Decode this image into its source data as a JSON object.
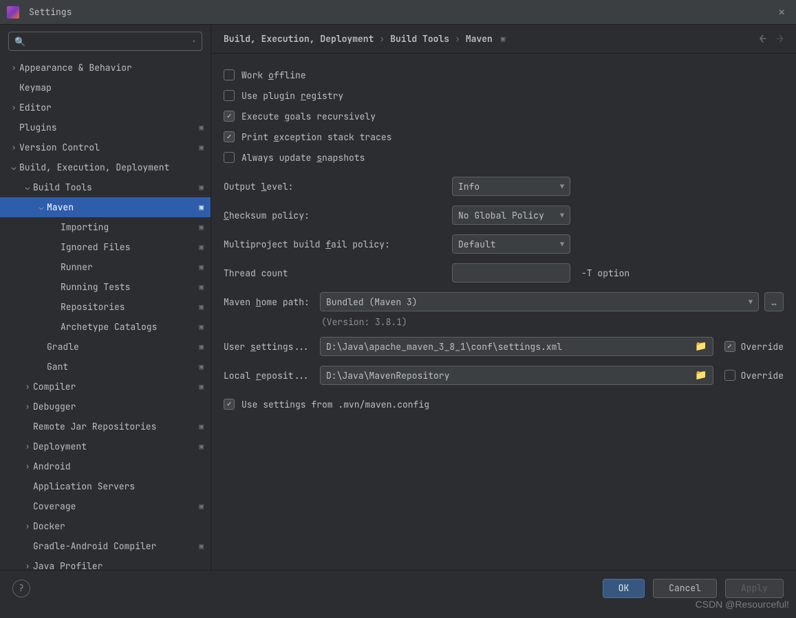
{
  "window": {
    "title": "Settings"
  },
  "search": {
    "placeholder": ""
  },
  "tree": [
    {
      "label": "Appearance & Behavior",
      "indent": 0,
      "arrow": "right",
      "mod": false
    },
    {
      "label": "Keymap",
      "indent": 0,
      "arrow": "",
      "mod": false
    },
    {
      "label": "Editor",
      "indent": 0,
      "arrow": "right",
      "mod": false
    },
    {
      "label": "Plugins",
      "indent": 0,
      "arrow": "",
      "mod": true
    },
    {
      "label": "Version Control",
      "indent": 0,
      "arrow": "right",
      "mod": true
    },
    {
      "label": "Build, Execution, Deployment",
      "indent": 0,
      "arrow": "down",
      "mod": false
    },
    {
      "label": "Build Tools",
      "indent": 1,
      "arrow": "down",
      "mod": true
    },
    {
      "label": "Maven",
      "indent": 2,
      "arrow": "down",
      "mod": true,
      "selected": true
    },
    {
      "label": "Importing",
      "indent": 3,
      "arrow": "",
      "mod": true
    },
    {
      "label": "Ignored Files",
      "indent": 3,
      "arrow": "",
      "mod": true
    },
    {
      "label": "Runner",
      "indent": 3,
      "arrow": "",
      "mod": true
    },
    {
      "label": "Running Tests",
      "indent": 3,
      "arrow": "",
      "mod": true
    },
    {
      "label": "Repositories",
      "indent": 3,
      "arrow": "",
      "mod": true
    },
    {
      "label": "Archetype Catalogs",
      "indent": 3,
      "arrow": "",
      "mod": true
    },
    {
      "label": "Gradle",
      "indent": 2,
      "arrow": "",
      "mod": true
    },
    {
      "label": "Gant",
      "indent": 2,
      "arrow": "",
      "mod": true
    },
    {
      "label": "Compiler",
      "indent": 1,
      "arrow": "right",
      "mod": true
    },
    {
      "label": "Debugger",
      "indent": 1,
      "arrow": "right",
      "mod": false
    },
    {
      "label": "Remote Jar Repositories",
      "indent": 1,
      "arrow": "",
      "mod": true
    },
    {
      "label": "Deployment",
      "indent": 1,
      "arrow": "right",
      "mod": true
    },
    {
      "label": "Android",
      "indent": 1,
      "arrow": "right",
      "mod": false
    },
    {
      "label": "Application Servers",
      "indent": 1,
      "arrow": "",
      "mod": false
    },
    {
      "label": "Coverage",
      "indent": 1,
      "arrow": "",
      "mod": true
    },
    {
      "label": "Docker",
      "indent": 1,
      "arrow": "right",
      "mod": false
    },
    {
      "label": "Gradle-Android Compiler",
      "indent": 1,
      "arrow": "",
      "mod": true
    },
    {
      "label": "Java Profiler",
      "indent": 1,
      "arrow": "right",
      "mod": false
    }
  ],
  "breadcrumb": {
    "items": [
      "Build, Execution, Deployment",
      "Build Tools",
      "Maven"
    ]
  },
  "checks": {
    "work_offline": {
      "label_pre": "Work ",
      "u": "o",
      "label_post": "ffline",
      "checked": false
    },
    "use_plugin_registry": {
      "label_pre": "Use plugin ",
      "u": "r",
      "label_post": "egistry",
      "checked": false
    },
    "exec_goals": {
      "label_pre": "Execute ",
      "u": "g",
      "label_post": "oals recursively",
      "checked": true
    },
    "print_exc": {
      "label_pre": "Print ",
      "u": "e",
      "label_post": "xception stack traces",
      "checked": true
    },
    "always_update": {
      "label_pre": "Always update ",
      "u": "s",
      "label_post": "napshots",
      "checked": false
    },
    "use_mvn_config": {
      "label": "Use settings from .mvn/maven.config",
      "checked": true
    }
  },
  "fields": {
    "output_level": {
      "label_pre": "Output ",
      "u": "l",
      "label_post": "evel:",
      "value": "Info"
    },
    "checksum": {
      "label_pre": "",
      "u": "C",
      "label_post": "hecksum policy:",
      "value": "No Global Policy"
    },
    "multiproject": {
      "label_pre": "Multiproject build ",
      "u": "f",
      "label_post": "ail policy:",
      "value": "Default"
    },
    "thread_count": {
      "label": "Thread count",
      "value": "",
      "suffix": "-T option"
    },
    "maven_home": {
      "label_pre": "Maven ",
      "u": "h",
      "label_post": "ome path:",
      "value": "Bundled (Maven 3)",
      "version": "(Version: 3.8.1)"
    },
    "user_settings": {
      "label_pre": "User ",
      "u": "s",
      "label_post": "ettings...",
      "value": "D:\\Java\\apache_maven_3_8_1\\conf\\settings.xml",
      "override_label": "Override",
      "override_checked": true
    },
    "local_repo": {
      "label_pre": "Local ",
      "u": "r",
      "label_post": "eposit...",
      "value": "D:\\Java\\MavenRepository",
      "override_label": "Override",
      "override_checked": false
    }
  },
  "buttons": {
    "ok": "OK",
    "cancel": "Cancel",
    "apply": "Apply"
  },
  "watermark": "CSDN @Resourceful!"
}
